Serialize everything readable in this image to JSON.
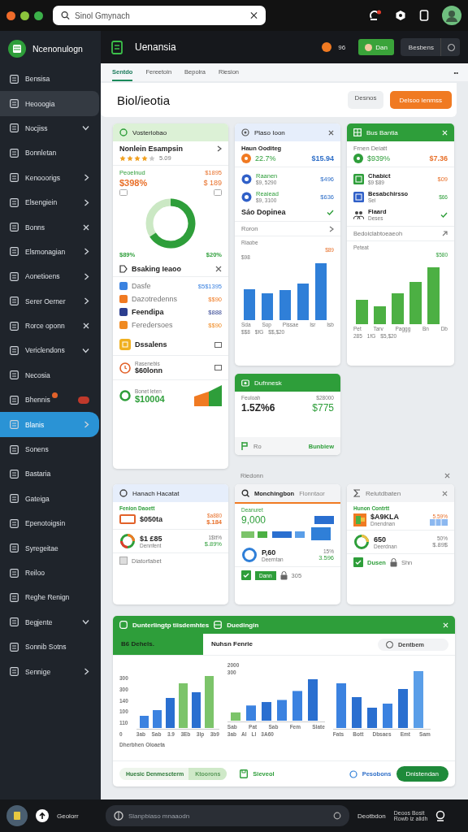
{
  "topbar": {
    "search": {
      "value": "Sinol Gmynach"
    }
  },
  "sidebar": {
    "brand": "Ncenonulogn",
    "items": [
      {
        "label": "Bensisa",
        "kind": "plain",
        "selected": false,
        "highlighted": false,
        "alert": false
      },
      {
        "label": "Heooogia",
        "kind": "plain",
        "selected": false,
        "highlighted": true,
        "alert": false
      },
      {
        "label": "Nocjiss",
        "kind": "expandable",
        "selected": false,
        "highlighted": false,
        "alert": false
      },
      {
        "label": "Bonnletan",
        "kind": "plain",
        "selected": false,
        "highlighted": false,
        "alert": false
      },
      {
        "label": "Kenooorigs",
        "kind": "submenu",
        "selected": false,
        "highlighted": false,
        "alert": false
      },
      {
        "label": "Elsengiein",
        "kind": "submenu",
        "selected": false,
        "highlighted": false,
        "alert": false
      },
      {
        "label": "Bonns",
        "kind": "closable",
        "selected": false,
        "highlighted": false,
        "alert": false
      },
      {
        "label": "Elsmonagian",
        "kind": "submenu",
        "selected": false,
        "highlighted": false,
        "alert": false
      },
      {
        "label": "Aonetioens",
        "kind": "submenu",
        "selected": false,
        "highlighted": false,
        "alert": false
      },
      {
        "label": "Serer Oerner",
        "kind": "submenu",
        "selected": false,
        "highlighted": false,
        "alert": false
      },
      {
        "label": "Rorce oponn",
        "kind": "closable",
        "selected": false,
        "highlighted": false,
        "alert": false
      },
      {
        "label": "Vericlendons",
        "kind": "expandable",
        "selected": false,
        "highlighted": false,
        "alert": false
      },
      {
        "label": "Necosia",
        "kind": "plain",
        "selected": false,
        "highlighted": false,
        "alert": false
      },
      {
        "label": "Bhennis",
        "kind": "plain",
        "selected": false,
        "highlighted": false,
        "alert": true
      },
      {
        "label": "Blanis",
        "kind": "submenu",
        "selected": true,
        "highlighted": false,
        "alert": false
      },
      {
        "label": "Sonens",
        "kind": "plain",
        "selected": false,
        "highlighted": false,
        "alert": false
      },
      {
        "label": "Bastaria",
        "kind": "plain",
        "selected": false,
        "highlighted": false,
        "alert": false
      },
      {
        "label": "Gateiga",
        "kind": "plain",
        "selected": false,
        "highlighted": false,
        "alert": false
      },
      {
        "label": "Epenotoigsin",
        "kind": "plain",
        "selected": false,
        "highlighted": false,
        "alert": false
      },
      {
        "label": "Syregeitae",
        "kind": "plain",
        "selected": false,
        "highlighted": false,
        "alert": false
      },
      {
        "label": "Reiloo",
        "kind": "plain",
        "selected": false,
        "highlighted": false,
        "alert": false
      },
      {
        "label": "Reghe Renign",
        "kind": "plain",
        "selected": false,
        "highlighted": false,
        "alert": false
      },
      {
        "label": "Begjente",
        "kind": "expandable",
        "selected": false,
        "highlighted": false,
        "alert": false
      },
      {
        "label": "Sonnib Sotns",
        "kind": "plain",
        "selected": false,
        "highlighted": false,
        "alert": false
      },
      {
        "label": "Sennige",
        "kind": "submenu",
        "selected": false,
        "highlighted": false,
        "alert": false
      }
    ],
    "user": "Geolorr"
  },
  "header": {
    "title": "Uenansia",
    "count": "96",
    "primary_button": "Dan",
    "secondary_button": "Besbens"
  },
  "tabs": [
    {
      "label": "Sentdo",
      "selected": true
    },
    {
      "label": "Fereetoin",
      "selected": false
    },
    {
      "label": "Bepolra",
      "selected": false
    },
    {
      "label": "Riesion",
      "selected": false
    }
  ],
  "tabs_more": "••",
  "page": {
    "title": "Biol/ieotia",
    "buttons": [
      {
        "label": "Desnos",
        "kind": "secondary"
      },
      {
        "label": "Delsoo lenmss",
        "kind": "primary"
      }
    ]
  },
  "card_1": {
    "title": "Vosterlobao",
    "product": "Nonlein Esampsin",
    "stars": 4,
    "rating": "5.09",
    "stat_label": "Peoelnud",
    "stat_value": "$398%",
    "stat_side": "$1895",
    "stat_side_2": "$ 189",
    "donut_left": "$89%",
    "donut_right": "$20%",
    "section": "Bsaking Ieaoo",
    "list": [
      {
        "label": "Dasfe",
        "value": "$5$1395",
        "color": "#3b82e0"
      },
      {
        "label": "Dazotredenns",
        "value": "$$90",
        "color": "#f07a22"
      },
      {
        "label": "Feendipa",
        "value": "$888",
        "color": "#2c3e8f"
      },
      {
        "label": "Feredersoes",
        "value": "$$90",
        "color": "#f08a22"
      }
    ],
    "row_a": "Dssalens",
    "row_b_label": "Rasenebis",
    "row_b_value": "$60lonn",
    "total_label": "Bonet leten",
    "total_value": "$10004"
  },
  "card_2": {
    "title": "Plaso Ioon",
    "head_label": "Haun Ooditeg",
    "head_pct": "22.7%",
    "head_value": "$15.94",
    "rows": [
      {
        "label": "Raanen",
        "sub": "$9, 5290",
        "value": "$496"
      },
      {
        "label": "Reaiead",
        "sub": "$9, 3100",
        "value": "$636"
      }
    ],
    "check_row": "Sáo Dopinea",
    "link_row": "Roron",
    "chart_title": "Riaobe",
    "chart_top": "$89",
    "chart_side": "$98",
    "x_labels": [
      "Sda",
      "Sop",
      "Pissae",
      "Isr",
      "Isb"
    ],
    "x_sub": [
      "$$8",
      "$fG",
      "$$,$20"
    ]
  },
  "card_3": {
    "title": "Bus Bantia",
    "head_label": "Frnen Deiatt",
    "head_pct": "$939%",
    "head_value": "$7.36",
    "rows": [
      {
        "label": "Chabict",
        "sub": "$9 $89",
        "value": "$09"
      },
      {
        "label": "Besabchirsso",
        "sub": "Sei",
        "value": "$66"
      }
    ],
    "check_label": "Flaard",
    "check_sub": "Deses",
    "link_row": "Bedoiclabtoeaeoh",
    "chart_title": "Peteat",
    "chart_top": "$580",
    "x_labels": [
      "Pet",
      "Tarv",
      "Paggg",
      "Bn",
      "Db"
    ],
    "x_sub": [
      "285",
      "1fG",
      "$5,$20"
    ]
  },
  "card_4": {
    "title": "Dufnnesk",
    "label": "Feuloah",
    "value": "1.5Z%6",
    "side": "$28000",
    "side_value": "$775",
    "footer_label": "Ro",
    "footer_link": "Bunbiew"
  },
  "section_label": "Riedonn",
  "card_5": {
    "title": "Hanach Hacatat",
    "label": "Fenion Daoett",
    "value": "$050ta",
    "side": "$a880",
    "side_value": "$.184",
    "ring_value": "$1 £85",
    "ring_sub": "Dennfent",
    "ring_side": "1$tt%",
    "ring_side_value": "$.89%",
    "footer": "Diatorfabet"
  },
  "card_6": {
    "tabs": [
      {
        "label": "Monchingbon",
        "selected": true
      },
      {
        "label": "Flonntaor",
        "selected": false
      }
    ],
    "label": "Deanuret",
    "value": "9,000",
    "ring_value": "P,60",
    "ring_sub": "Deerntan",
    "ring_side": "15%",
    "ring_side_value": "3.596",
    "pill": "Dann",
    "lock_label": "305"
  },
  "card_7": {
    "title": "Relutdbaten",
    "label": "Hunon Contrtt",
    "value": "$A9KLA",
    "sub": "Dnendnan",
    "side": "5.59%",
    "ring_value": "650",
    "ring_sub": "Deerdnan",
    "ring_side": "50%",
    "ring_side_value": "$.89$",
    "footer_link": "Dusen",
    "lock_label": "Shn"
  },
  "chart_card": {
    "title": "Dunterlingtp tiisdemhtes",
    "title_2": "Duedingin",
    "tabs": [
      {
        "label": "B6 Dehels.",
        "selected": true
      },
      {
        "label": "Nuhsn Fenrie",
        "selected": false
      }
    ],
    "filter": "Dentbem",
    "y_labels": [
      "300",
      "300",
      "140",
      "100",
      "110",
      "0"
    ],
    "x_labels_1": [
      "3ab",
      "Sab",
      "3.9",
      "3Eb",
      "3lp",
      "3b9"
    ],
    "x_labels_2": [
      "Sab",
      "Pat",
      "Sab",
      "Fem",
      "Slate"
    ],
    "x_sub_2": [
      "3ab",
      "Al",
      "Ll",
      "3A60"
    ],
    "x_labels_3": [
      "Fats",
      "Bott",
      "Dbsaes",
      "Emt",
      "Sam"
    ],
    "side_tick": "300",
    "side_tick_2": "2000",
    "caption": "Dherbhen Oloaeta",
    "segment": "Huesic Denmescterm",
    "segment_select": "Ktoorons",
    "save": "Sieveol",
    "link": "Pesobons",
    "button": "Dnistendan"
  },
  "bottombar": {
    "search_placeholder": "Slanpbiaso mnaaodn",
    "label": "Deotbdon",
    "info_1": "Deoos Bosit",
    "info_2": "Rowb iz alidh"
  }
}
